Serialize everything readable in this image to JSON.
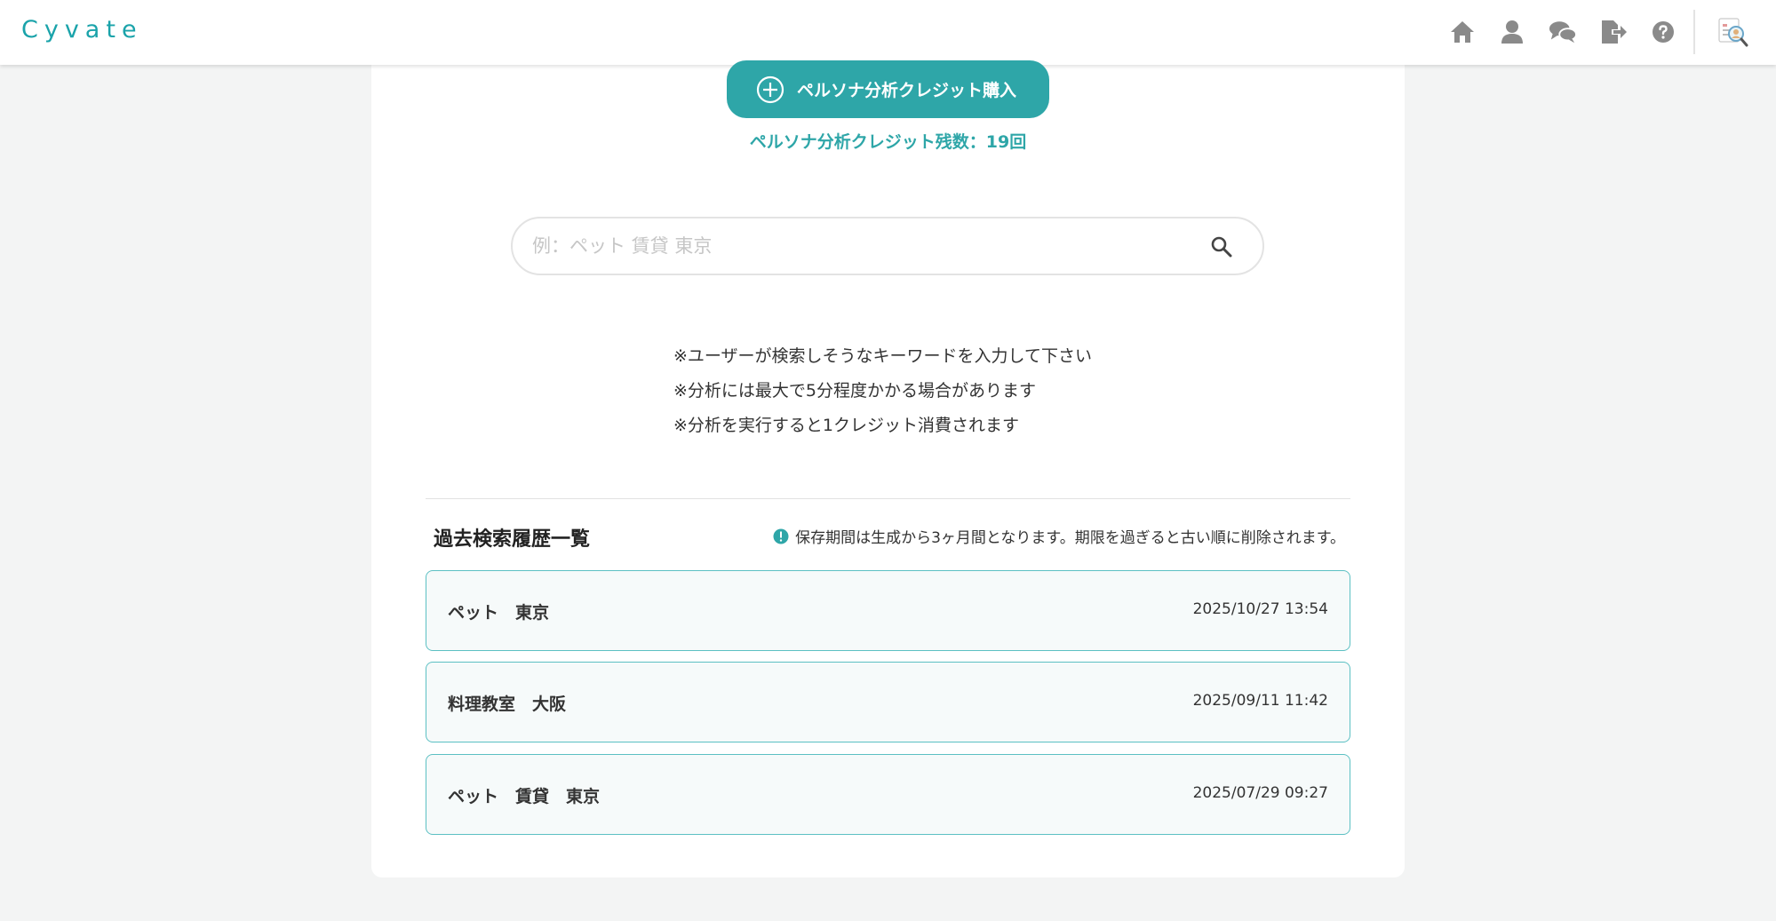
{
  "header": {
    "logo": "Cyvate",
    "icons": [
      "home-icon",
      "user-icon",
      "chat-icon",
      "logout-icon",
      "help-icon"
    ],
    "accent_color": "#1aa3aa"
  },
  "purchase": {
    "button_label": "ペルソナ分析クレジット購入",
    "remaining_label": "ペルソナ分析クレジット残数：19回"
  },
  "search": {
    "placeholder": "例：ペット 賃貸 東京",
    "value": ""
  },
  "notes": [
    "※ユーザーが検索しそうなキーワードを入力して下さい",
    "※分析には最大で5分程度かかる場合があります",
    "※分析を実行すると1クレジット消費されます"
  ],
  "history": {
    "title": "過去検索履歴一覧",
    "retention_note": "保存期間は生成から3ヶ月間となります。期限を過ぎると古い順に削除されます。",
    "items": [
      {
        "keyword": "ペット　東京",
        "timestamp": "2025/10/27 13:54"
      },
      {
        "keyword": "料理教室　大阪",
        "timestamp": "2025/09/11 11:42"
      },
      {
        "keyword": "ペット　賃貸　東京",
        "timestamp": "2025/07/29 09:27"
      }
    ]
  }
}
